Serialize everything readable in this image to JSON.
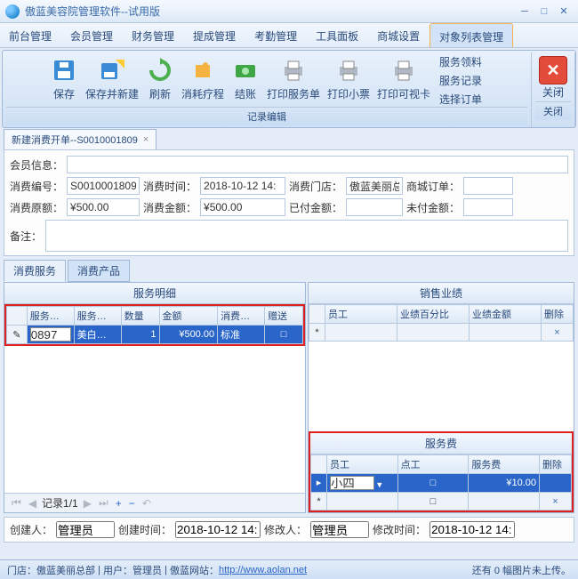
{
  "window": {
    "title": "傲蓝美容院管理软件--试用版"
  },
  "menu": {
    "items": [
      "前台管理",
      "会员管理",
      "财务管理",
      "提成管理",
      "考勤管理",
      "工具面板",
      "商城设置",
      "对象列表管理"
    ],
    "active_index": 7
  },
  "ribbon": {
    "group1_label": "记录编辑",
    "save": "保存",
    "save_new": "保存并新建",
    "refresh": "刷新",
    "cancel_course": "消耗疗程",
    "settle": "结账",
    "print_service": "打印服务单",
    "print_receipt": "打印小票",
    "print_card": "打印可视卡",
    "svc_receive": "服务领料",
    "svc_record": "服务记录",
    "select_order": "选择订单",
    "close_group_label": "关闭",
    "close": "关闭"
  },
  "doc_tab": {
    "title": "新建消费开单--S0010001809"
  },
  "form": {
    "member_info_label": "会员信息：",
    "member_info_value": "",
    "consume_no_label": "消费编号：",
    "consume_no_value": "S0010001809",
    "consume_time_label": "消费时间：",
    "consume_time_value": "2018-10-12 14:",
    "consume_store_label": "消费门店：",
    "consume_store_value": "傲蓝美丽总",
    "mall_order_label": "商城订单：",
    "mall_order_value": "",
    "orig_amount_label": "消费原额：",
    "orig_amount_value": "¥500.00",
    "consume_amount_label": "消费金额：",
    "consume_amount_value": "¥500.00",
    "paid_label": "已付金额：",
    "paid_value": "",
    "unpaid_label": "未付金额：",
    "unpaid_value": "",
    "remark_label": "备注："
  },
  "inner_tabs": {
    "tab1": "消费服务",
    "tab2": "消费产品"
  },
  "service_detail": {
    "title": "服务明细",
    "headers": [
      "服务…",
      "服务…",
      "数量",
      "金额",
      "消费…",
      "赠送"
    ],
    "row": {
      "code": "0897",
      "name": "美白…",
      "qty": "1",
      "amount": "¥500.00",
      "type": "标准",
      "gift": "□"
    },
    "pager": "记录1/1"
  },
  "sales_perf": {
    "title": "销售业绩",
    "headers": [
      "员工",
      "业绩百分比",
      "业绩金额",
      "删除"
    ]
  },
  "service_fee": {
    "title": "服务费",
    "headers": [
      "员工",
      "点工",
      "服务费",
      "删除"
    ],
    "row": {
      "emp": "小四",
      "pt": "□",
      "fee": "¥10.00"
    }
  },
  "footer": {
    "creator_label": "创建人：",
    "creator_value": "管理员",
    "create_time_label": "创建时间：",
    "create_time_value": "2018-10-12 14:",
    "modifier_label": "修改人：",
    "modifier_value": "管理员",
    "modify_time_label": "修改时间：",
    "modify_time_value": "2018-10-12 14:"
  },
  "status": {
    "store_label": "门店：",
    "store": "傲蓝美丽总部",
    "user_label": "用户：",
    "user": "管理员",
    "site_label": "傲蓝网站：",
    "site_url": "http://www.aolan.net",
    "upload_msg": "还有 0 幅图片未上传。"
  }
}
